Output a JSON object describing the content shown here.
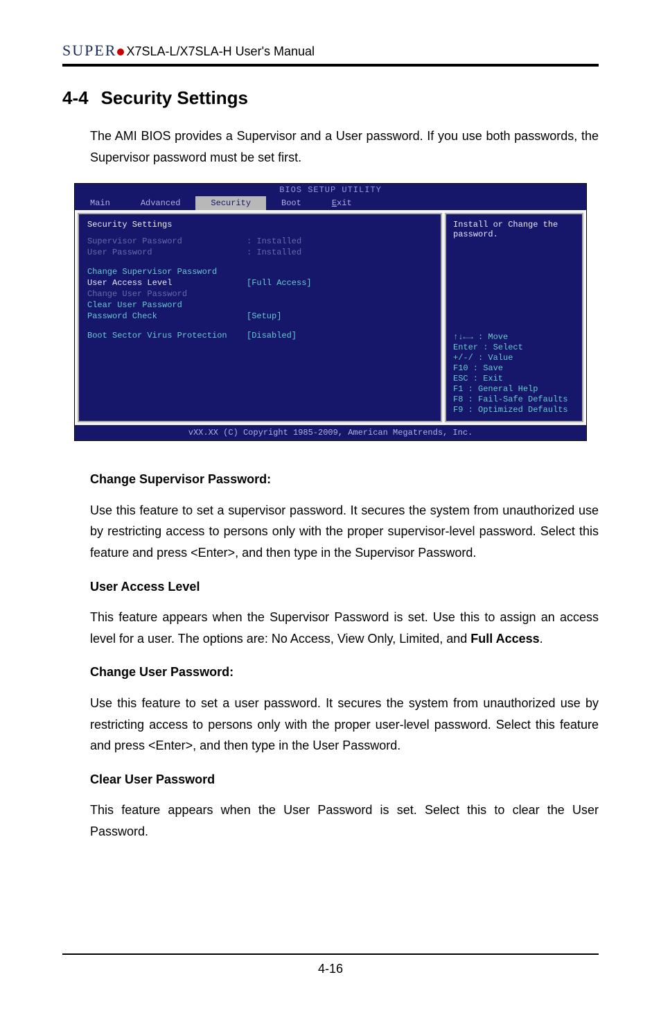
{
  "header": {
    "brand": "SUPER",
    "manual": "X7SLA-L/X7SLA-H User's Manual"
  },
  "section": {
    "number": "4-4",
    "title": "Security Settings"
  },
  "intro": "The AMI BIOS provides a Supervisor and a User password. If you use both passwords, the Supervisor password must be set first.",
  "bios": {
    "title": "BIOS SETUP UTILITY",
    "tabs": [
      "Main",
      "Advanced",
      "Security",
      "Boot",
      "Exit"
    ],
    "active_tab": "Security",
    "panel_heading": "Security Settings",
    "status": {
      "supervisor_label": "Supervisor Password",
      "supervisor_value": ": Installed",
      "user_label": "User Password",
      "user_value": ": Installed"
    },
    "items": {
      "change_supervisor": "Change Supervisor Password",
      "user_access_level_label": "User Access Level",
      "user_access_level_value": "[Full Access]",
      "change_user": "Change User Password",
      "clear_user": "Clear User Password",
      "password_check_label": "Password Check",
      "password_check_value": "[Setup]",
      "boot_sector_label": "Boot Sector Virus Protection",
      "boot_sector_value": "[Disabled]"
    },
    "help_title": "Install or Change the password.",
    "keys": {
      "move": "↑↓←→ : Move",
      "enter": "Enter : Select",
      "value": "+/-/ : Value",
      "save": "F10 : Save",
      "exit": "ESC : Exit",
      "general": "F1 : General Help",
      "failsafe": "F8 : Fail-Safe Defaults",
      "optimized": "F9 : Optimized Defaults"
    },
    "footer": "vXX.XX (C) Copyright 1985-2009, American Megatrends, Inc."
  },
  "content": {
    "h1": "Change Supervisor Password:",
    "p1": "Use this feature to set a supervisor password. It secures the system from unauthorized use by restricting access to persons only with the proper supervisor-level password.  Select this feature and press <Enter>, and then type in the Supervisor Password.",
    "h2": "User Access Level",
    "p2a": "This feature appears when the Supervisor Password is set. Use this to assign an access level for a user. The options are: No Access, View Only, Limited, and ",
    "p2b": "Full Access",
    "p2c": ".",
    "h3": "Change User Password:",
    "p3": "Use this feature to set a user password. It secures the system from unauthorized use by restricting access to persons only with the proper user-level password.  Select this feature and press <Enter>, and then type in the User Password.",
    "h4": "Clear User Password",
    "p4": "This feature appears when the User Password is set. Select this to clear the User Password."
  },
  "page_number": "4-16"
}
